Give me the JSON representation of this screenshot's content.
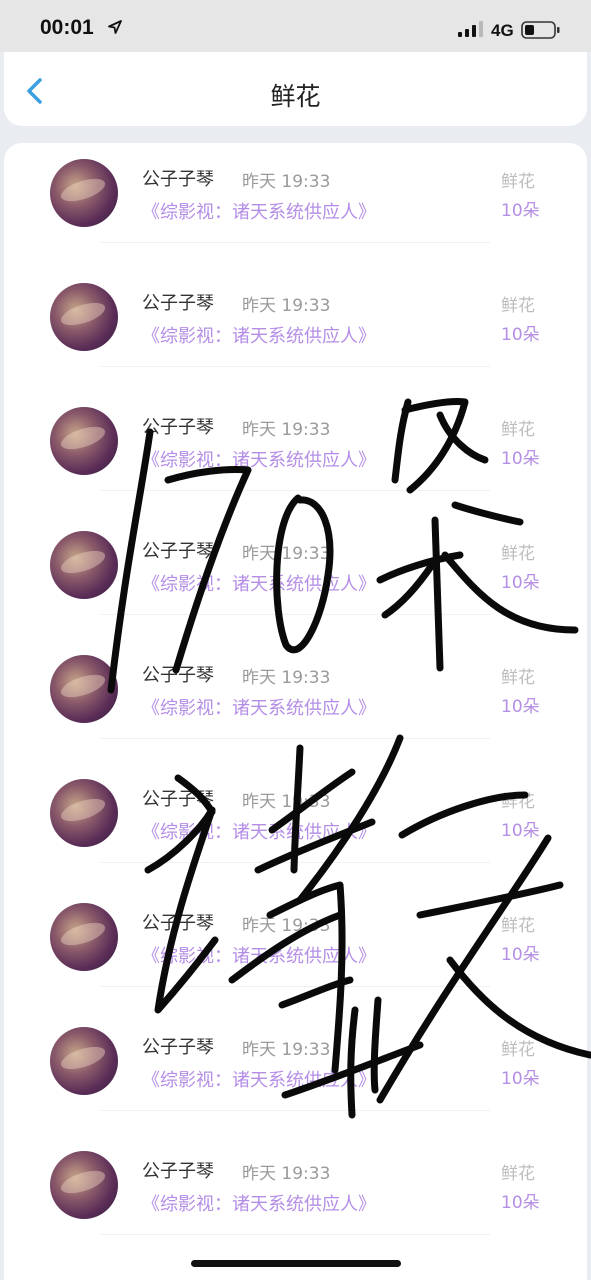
{
  "status_bar": {
    "time": "00:01",
    "network": "4G"
  },
  "header": {
    "title": "鲜花"
  },
  "list": {
    "items": [
      {
        "name": "公子子琴",
        "time": "昨天 19:33",
        "book": "《综影视：诸天系统供应人》",
        "gift": "鲜花",
        "count": "10朵"
      },
      {
        "name": "公子子琴",
        "time": "昨天 19:33",
        "book": "《综影视：诸天系统供应人》",
        "gift": "鲜花",
        "count": "10朵"
      },
      {
        "name": "公子子琴",
        "time": "昨天 19:33",
        "book": "《综影视：诸天系统供应人》",
        "gift": "鲜花",
        "count": "10朵"
      },
      {
        "name": "公子子琴",
        "time": "昨天 19:33",
        "book": "《综影视：诸天系统供应人》",
        "gift": "鲜花",
        "count": "10朵"
      },
      {
        "name": "公子子琴",
        "time": "昨天 19:33",
        "book": "《综影视：诸天系统供应人》",
        "gift": "鲜花",
        "count": "10朵"
      },
      {
        "name": "公子子琴",
        "time": "昨天 19:33",
        "book": "《综影视：诸天系统供应人》",
        "gift": "鲜花",
        "count": "10朵"
      },
      {
        "name": "公子子琴",
        "time": "昨天 19:33",
        "book": "《综影视：诸天系统供应人》",
        "gift": "鲜花",
        "count": "10朵"
      },
      {
        "name": "公子子琴",
        "time": "昨天 19:33",
        "book": "《综影视：诸天系统供应人》",
        "gift": "鲜花",
        "count": "10朵"
      },
      {
        "name": "公子子琴",
        "time": "昨天 19:33",
        "book": "《综影视：诸天系统供应人》",
        "gift": "鲜花",
        "count": "10朵"
      }
    ]
  },
  "handwriting": {
    "line1": "170朵",
    "line2": "诸天"
  },
  "colors": {
    "accent": "#b58ee6",
    "back_arrow": "#3b9fe0",
    "page_bg": "#e9edf2"
  }
}
